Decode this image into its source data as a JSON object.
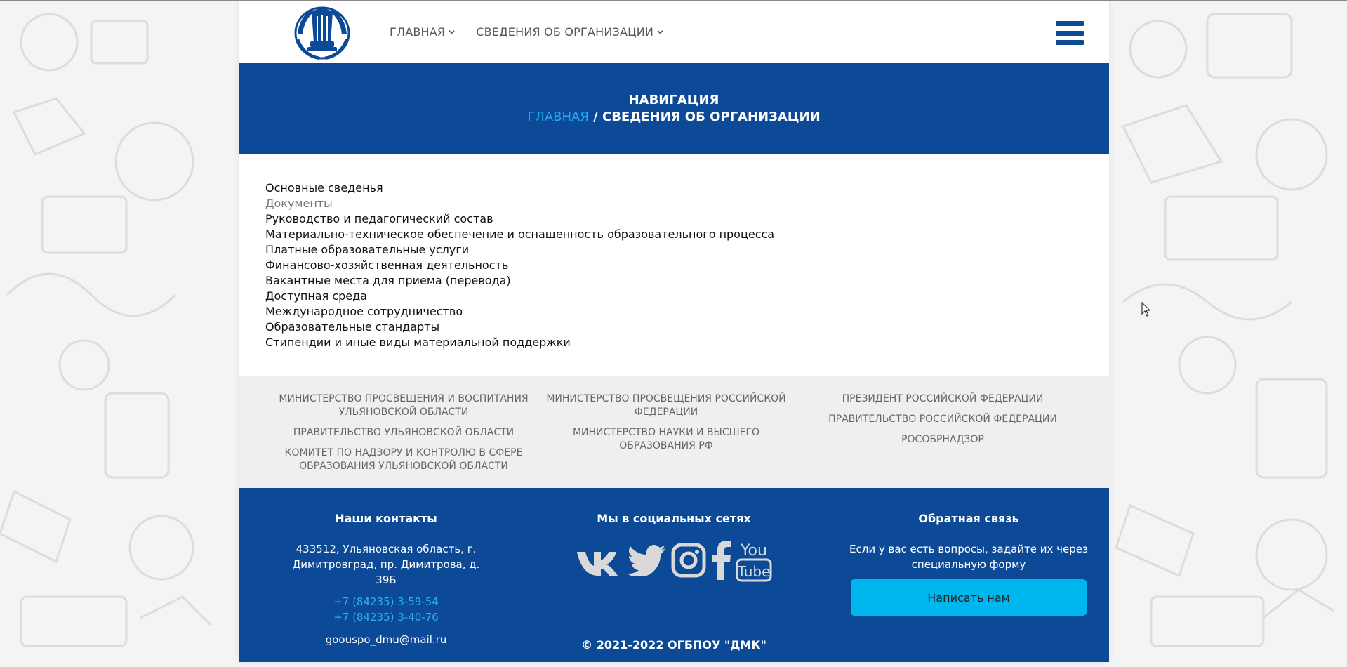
{
  "header": {
    "nav": [
      {
        "label": "ГЛАВНАЯ"
      },
      {
        "label": "СВЕДЕНИЯ ОБ ОРГАНИЗАЦИИ"
      }
    ],
    "logo_icon": "lyre-laurel-logo",
    "menu_icon": "hamburger-menu-icon"
  },
  "navigation": {
    "title": "НАВИГАЦИЯ",
    "breadcrumb_home": "ГЛАВНАЯ",
    "breadcrumb_sep": " / ",
    "breadcrumb_current": "СВЕДЕНИЯ ОБ ОРГАНИЗАЦИИ"
  },
  "sections": [
    "Основные сведенья",
    "Документы",
    "Руководство и педагогический состав",
    "Материально-техническое обеспечение и оснащенность образовательного процесса",
    "Платные образовательные услуги",
    "Финансово-хозяйственная деятельность",
    "Вакантные места для приема (перевода)",
    "Доступная среда",
    "Международное сотрудничество",
    "Образовательные стандарты",
    "Стипендии и иные виды материальной поддержки"
  ],
  "active_section": "Документы",
  "partners": {
    "col1": [
      "МИНИСТЕРСТВО ПРОСВЕЩЕНИЯ И ВОСПИТАНИЯ УЛЬЯНОВСКОЙ ОБЛАСТИ",
      "ПРАВИТЕЛЬСТВО УЛЬЯНОВСКОЙ ОБЛАСТИ",
      "КОМИТЕТ ПО НАДЗОРУ И КОНТРОЛЮ В СФЕРЕ ОБРАЗОВАНИЯ УЛЬЯНОВСКОЙ ОБЛАСТИ"
    ],
    "col2": [
      "МИНИСТЕРСТВО ПРОСВЕЩЕНИЯ РОССИЙСКОЙ ФЕДЕРАЦИИ",
      "МИНИСТЕРСТВО НАУКИ И ВЫСШЕГО ОБРАЗОВАНИЯ РФ"
    ],
    "col3": [
      "ПРЕЗИДЕНТ РОССИЙСКОЙ ФЕДЕРАЦИИ",
      "ПРАВИТЕЛЬСТВО РОССИЙСКОЙ ФЕДЕРАЦИИ",
      "РОСОБРНАДЗОР"
    ]
  },
  "footer": {
    "contacts": {
      "title": "Наши контакты",
      "address": "433512, Ульяновская область, г. Димитровград, пр. Димитрова, д. 39Б",
      "phone1": "+7 (84235) 3-59-54",
      "phone2": "+7 (84235) 3-40-76",
      "email": "goouspo_dmu@mail.ru"
    },
    "social": {
      "title": "Мы в социальных сетях",
      "icons": [
        "vk-icon",
        "twitter-icon",
        "instagram-icon",
        "facebook-icon",
        "youtube-icon"
      ]
    },
    "feedback": {
      "title": "Обратная связь",
      "text": "Если у вас есть вопросы, задайте их через специальную форму",
      "button": "Написать нам"
    },
    "copyright": "© 2021-2022 ОГБПОУ \"ДМК\""
  },
  "colors": {
    "primary_blue": "#0c4a98",
    "link_blue": "#27a9f3",
    "button_cyan": "#00b6ef",
    "partners_bg": "#efefef"
  }
}
